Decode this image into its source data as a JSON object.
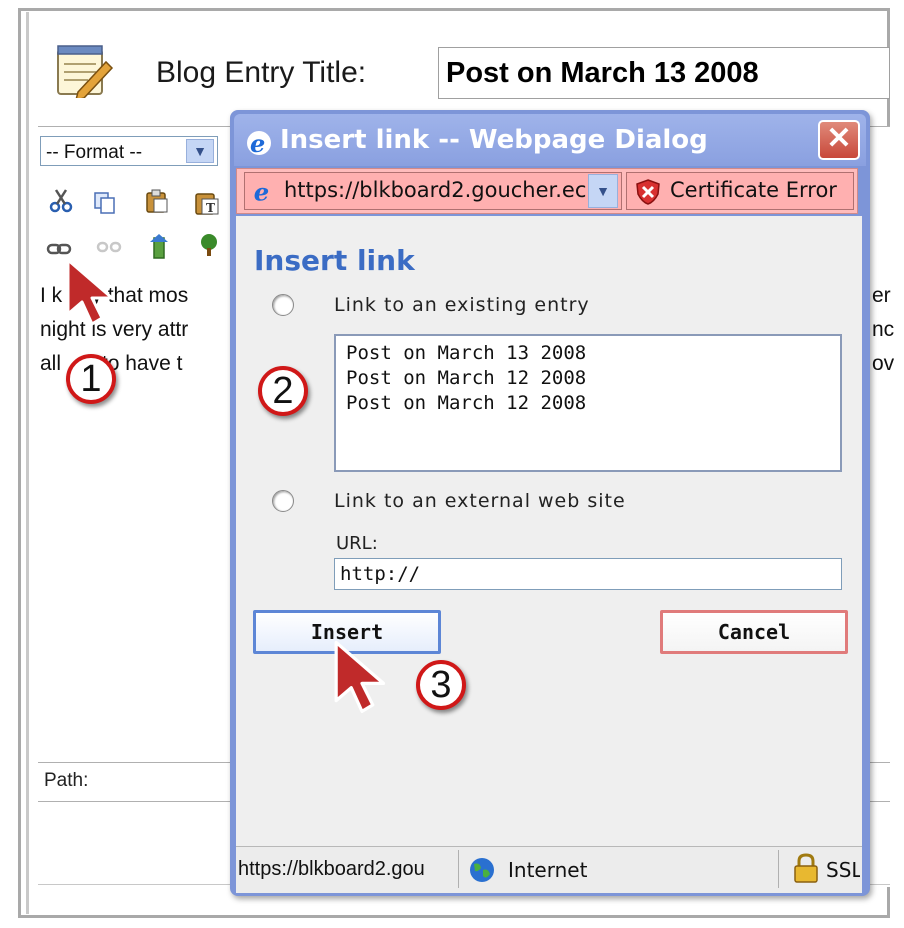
{
  "blog": {
    "title_label": "Blog Entry Title:",
    "title_value": "Post on March 13 2008"
  },
  "editor": {
    "format_select": "-- Format --",
    "body_lines_left": [
      "I k",
      "y that mos",
      "night",
      "is very attr",
      "all",
      "to have t"
    ],
    "body_lines_right": [
      "er",
      "nc",
      "ov"
    ],
    "path_label": "Path:"
  },
  "dialog": {
    "title": "Insert link -- Webpage Dialog",
    "address_url": "https://blkboard2.goucher.ec",
    "certificate_error": "Certificate Error",
    "heading": "Insert link",
    "option_existing": "Link to an existing entry",
    "entries": [
      "Post on March 13 2008",
      "Post on March 12 2008",
      "Post on March 12 2008"
    ],
    "option_external": "Link to an external web site",
    "url_label": "URL:",
    "url_value": "http://",
    "insert_label": "Insert",
    "cancel_label": "Cancel",
    "status_url": "https://blkboard2.gou",
    "status_zone": "Internet",
    "status_ssl": "SSL"
  },
  "callouts": [
    "1",
    "2",
    "3"
  ],
  "colors": {
    "dialog_border": "#7d95d8",
    "address_bar_error": "#ffbcbc",
    "heading_blue": "#3b6cc4",
    "callout_red": "#d01818",
    "insert_border": "#5d86d6",
    "cancel_border": "#e07b7b"
  },
  "icons": [
    "notepad-icon",
    "ie-icon",
    "close-icon",
    "shield-error-icon",
    "globe-icon",
    "lock-icon",
    "cursor-icon",
    "cut-icon",
    "copy-icon",
    "paste-icon",
    "paste-text-icon",
    "link-icon",
    "unlink-icon",
    "anchor-icon",
    "image-icon"
  ]
}
